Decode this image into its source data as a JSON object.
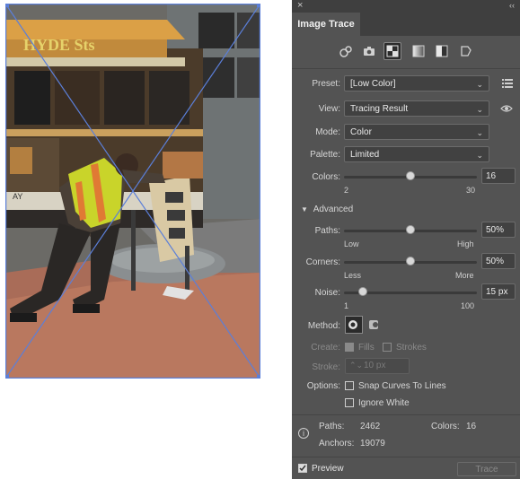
{
  "panel": {
    "title": "Image Trace",
    "preset": {
      "label": "Preset:",
      "value": "[Low Color]"
    },
    "view": {
      "label": "View:",
      "value": "Tracing Result"
    },
    "mode": {
      "label": "Mode:",
      "value": "Color"
    },
    "palette": {
      "label": "Palette:",
      "value": "Limited"
    },
    "colors": {
      "label": "Colors:",
      "value": "16",
      "min": "2",
      "max": "30",
      "level": 0.5
    },
    "advanced": {
      "label": "Advanced"
    },
    "paths": {
      "label": "Paths:",
      "value": "50%",
      "min": "Low",
      "max": "High",
      "level": 0.5
    },
    "corners": {
      "label": "Corners:",
      "value": "50%",
      "min": "Less",
      "max": "More",
      "level": 0.5
    },
    "noise": {
      "label": "Noise:",
      "value": "15 px",
      "min": "1",
      "max": "100",
      "level": 0.14
    },
    "method": {
      "label": "Method:"
    },
    "create": {
      "label": "Create:",
      "fills": "Fills",
      "strokes": "Strokes"
    },
    "stroke": {
      "label": "Stroke:",
      "value": "10 px"
    },
    "options": {
      "label": "Options:",
      "snap": "Snap Curves To Lines",
      "ignore_white": "Ignore White"
    },
    "info": {
      "paths_label": "Paths:",
      "paths_value": "2462",
      "colors_label": "Colors:",
      "colors_value": "16",
      "anchors_label": "Anchors:",
      "anchors_value": "19079"
    },
    "preview": "Preview",
    "trace": "Trace"
  },
  "artboard": {
    "sign_text": "HYDE Sts"
  },
  "colors": {
    "panel": "#535353",
    "selection": "#5b7fd9",
    "vest": "#c9d42a"
  }
}
